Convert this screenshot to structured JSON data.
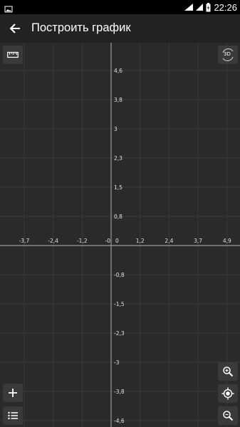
{
  "status_bar": {
    "time": "22:26",
    "icons": [
      "image-icon",
      "wifi-icon",
      "battery-charging-icon",
      "signal-icon"
    ]
  },
  "app_bar": {
    "title": "Построить график",
    "back_icon": "arrow-back-icon"
  },
  "graph": {
    "x_ticks": [
      "-3,7",
      "-2,4",
      "-1,2",
      "-0",
      "0",
      "1,2",
      "2,4",
      "3,7",
      "4,9"
    ],
    "y_ticks_positive": [
      "4,6",
      "3,8",
      "3",
      "2,3",
      "1,5",
      "0,8"
    ],
    "y_ticks_negative": [
      "-0,8",
      "-1,5",
      "-2,3",
      "-3",
      "-3,8",
      "-4,6"
    ],
    "colors": {
      "background": "#2a2a2a",
      "grid": "#3a3a3a",
      "axis": "#9a9a9a"
    }
  },
  "buttons": {
    "ruler": "ruler-icon",
    "mode_3d": "3D",
    "add": "plus-icon",
    "list": "list-icon",
    "zoom_in": "zoom-in-icon",
    "locate": "locate-icon",
    "zoom_out": "zoom-out-icon"
  }
}
